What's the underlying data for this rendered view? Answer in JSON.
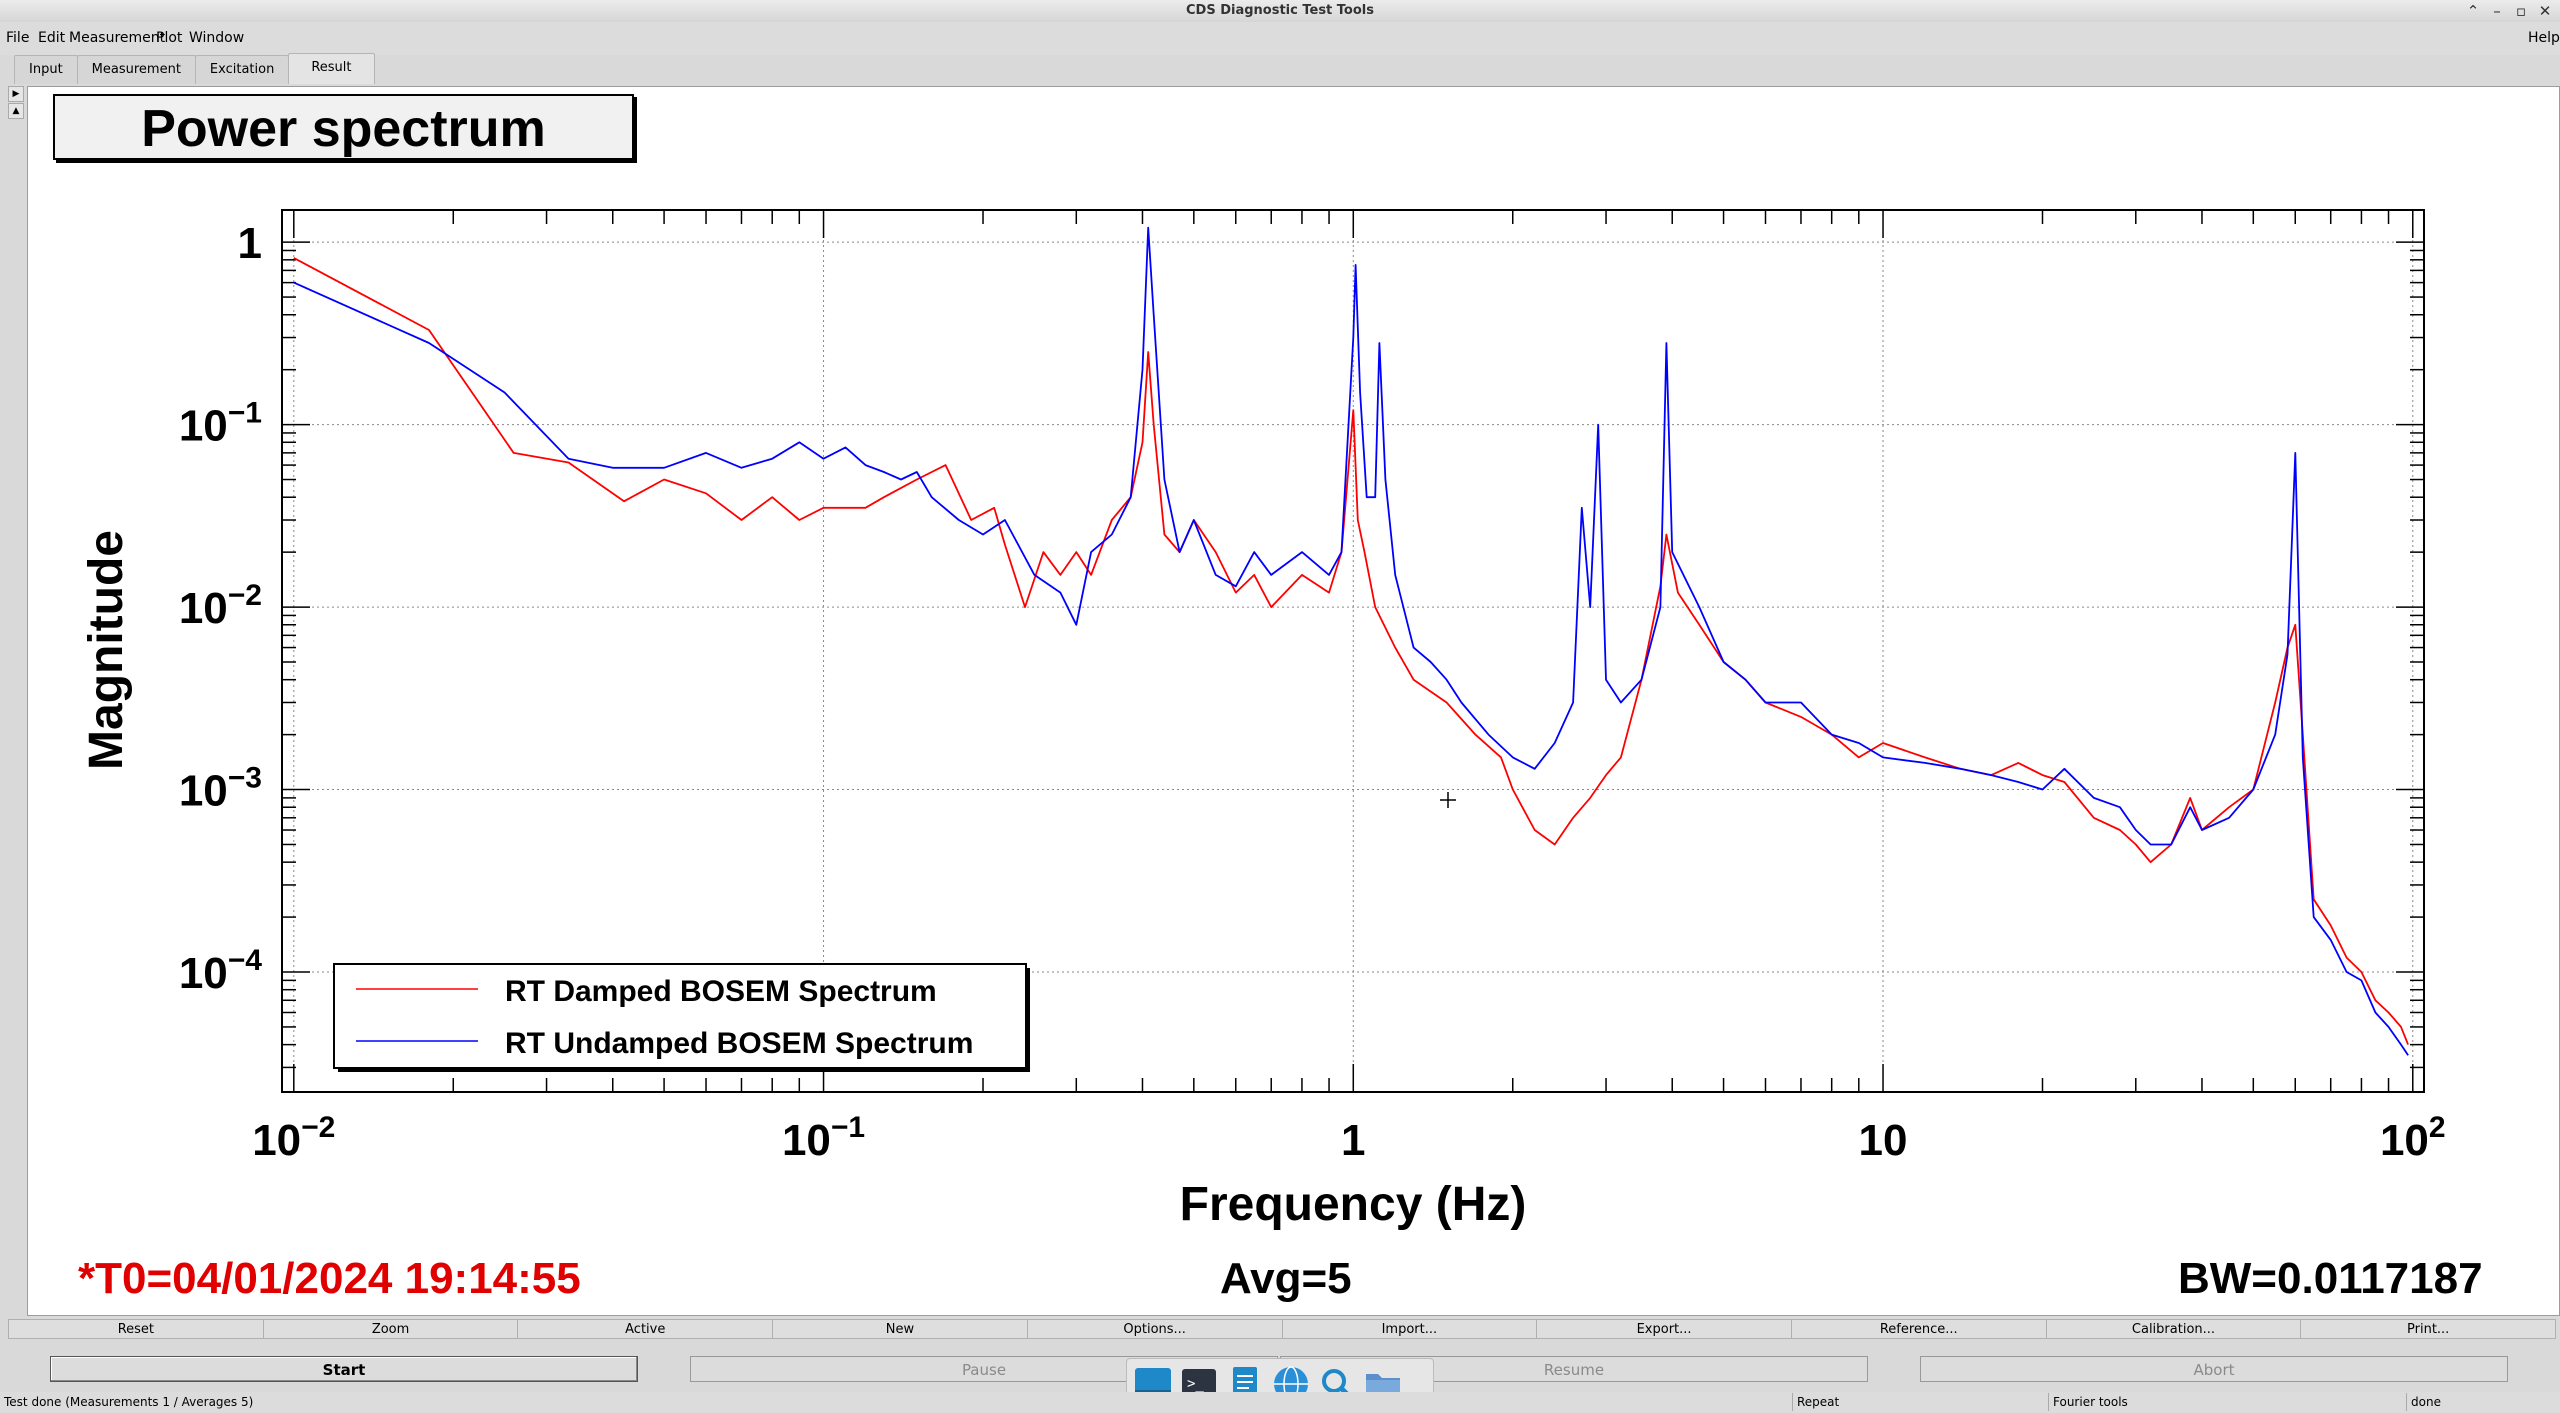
{
  "window": {
    "title": "CDS Diagnostic Test Tools"
  },
  "menu": {
    "file": "File",
    "edit": "Edit",
    "measurement": "Measurement",
    "plot": "Plot",
    "window": "Window",
    "help": "Help"
  },
  "tabs": [
    {
      "label": "Input",
      "active": false
    },
    {
      "label": "Measurement",
      "active": false
    },
    {
      "label": "Excitation",
      "active": false
    },
    {
      "label": "Result",
      "active": true
    }
  ],
  "plot_title": "Power spectrum",
  "chart_data": {
    "type": "line",
    "title": "Power spectrum",
    "xlabel": "Frequency (Hz)",
    "ylabel": "Magnitude",
    "xscale": "log",
    "yscale": "log",
    "xlim": [
      0.0095,
      105
    ],
    "ylim": [
      2.2e-05,
      1.5
    ],
    "x_ticks": [
      0.01,
      0.1,
      1,
      10,
      100
    ],
    "x_tick_labels": [
      {
        "base": "10",
        "exp": "−2"
      },
      {
        "base": "10",
        "exp": "−1"
      },
      {
        "base": "1",
        "exp": ""
      },
      {
        "base": "10",
        "exp": ""
      },
      {
        "base": "10",
        "exp": "2"
      }
    ],
    "y_ticks": [
      0.0001,
      0.001,
      0.01,
      0.1,
      1
    ],
    "y_tick_labels": [
      {
        "base": "10",
        "exp": "−4"
      },
      {
        "base": "10",
        "exp": "−3"
      },
      {
        "base": "10",
        "exp": "−2"
      },
      {
        "base": "10",
        "exp": "−1"
      },
      {
        "base": "1",
        "exp": ""
      }
    ],
    "grid": true,
    "legend_position": "bottom-left",
    "series": [
      {
        "name": "RT Damped BOSEM Spectrum",
        "color": "#ff0000",
        "points": [
          [
            0.01,
            0.82
          ],
          [
            0.018,
            0.33
          ],
          [
            0.026,
            0.07
          ],
          [
            0.033,
            0.062
          ],
          [
            0.042,
            0.038
          ],
          [
            0.05,
            0.05
          ],
          [
            0.06,
            0.042
          ],
          [
            0.07,
            0.03
          ],
          [
            0.08,
            0.04
          ],
          [
            0.09,
            0.03
          ],
          [
            0.1,
            0.035
          ],
          [
            0.12,
            0.035
          ],
          [
            0.13,
            0.04
          ],
          [
            0.15,
            0.05
          ],
          [
            0.17,
            0.06
          ],
          [
            0.19,
            0.03
          ],
          [
            0.21,
            0.035
          ],
          [
            0.22,
            0.022
          ],
          [
            0.24,
            0.01
          ],
          [
            0.26,
            0.02
          ],
          [
            0.28,
            0.015
          ],
          [
            0.3,
            0.02
          ],
          [
            0.32,
            0.015
          ],
          [
            0.35,
            0.03
          ],
          [
            0.38,
            0.04
          ],
          [
            0.4,
            0.08
          ],
          [
            0.41,
            0.25
          ],
          [
            0.42,
            0.1
          ],
          [
            0.44,
            0.025
          ],
          [
            0.47,
            0.02
          ],
          [
            0.5,
            0.03
          ],
          [
            0.55,
            0.02
          ],
          [
            0.6,
            0.012
          ],
          [
            0.65,
            0.015
          ],
          [
            0.7,
            0.01
          ],
          [
            0.8,
            0.015
          ],
          [
            0.9,
            0.012
          ],
          [
            0.95,
            0.02
          ],
          [
            1.0,
            0.12
          ],
          [
            1.02,
            0.03
          ],
          [
            1.05,
            0.02
          ],
          [
            1.1,
            0.01
          ],
          [
            1.2,
            0.006
          ],
          [
            1.3,
            0.004
          ],
          [
            1.5,
            0.003
          ],
          [
            1.7,
            0.002
          ],
          [
            1.9,
            0.0015
          ],
          [
            2.0,
            0.001
          ],
          [
            2.2,
            0.0006
          ],
          [
            2.4,
            0.0005
          ],
          [
            2.6,
            0.0007
          ],
          [
            2.8,
            0.0009
          ],
          [
            3.0,
            0.0012
          ],
          [
            3.2,
            0.0015
          ],
          [
            3.5,
            0.004
          ],
          [
            3.8,
            0.013
          ],
          [
            3.9,
            0.025
          ],
          [
            4.1,
            0.012
          ],
          [
            4.5,
            0.008
          ],
          [
            5,
            0.005
          ],
          [
            5.5,
            0.004
          ],
          [
            6,
            0.003
          ],
          [
            7,
            0.0025
          ],
          [
            8,
            0.002
          ],
          [
            9,
            0.0015
          ],
          [
            10,
            0.0018
          ],
          [
            12,
            0.0015
          ],
          [
            14,
            0.0013
          ],
          [
            16,
            0.0012
          ],
          [
            18,
            0.0014
          ],
          [
            20,
            0.0012
          ],
          [
            22,
            0.0011
          ],
          [
            25,
            0.0007
          ],
          [
            28,
            0.0006
          ],
          [
            30,
            0.0005
          ],
          [
            32,
            0.0004
          ],
          [
            35,
            0.0005
          ],
          [
            38,
            0.0009
          ],
          [
            40,
            0.0006
          ],
          [
            45,
            0.0008
          ],
          [
            50,
            0.001
          ],
          [
            55,
            0.003
          ],
          [
            58,
            0.006
          ],
          [
            60,
            0.008
          ],
          [
            62,
            0.002
          ],
          [
            65,
            0.00025
          ],
          [
            70,
            0.00018
          ],
          [
            75,
            0.00012
          ],
          [
            80,
            0.0001
          ],
          [
            85,
            7e-05
          ],
          [
            90,
            6e-05
          ],
          [
            95,
            5e-05
          ],
          [
            98,
            4e-05
          ]
        ]
      },
      {
        "name": "RT Undamped BOSEM Spectrum",
        "color": "#0000ff",
        "points": [
          [
            0.01,
            0.6
          ],
          [
            0.018,
            0.28
          ],
          [
            0.025,
            0.15
          ],
          [
            0.033,
            0.065
          ],
          [
            0.04,
            0.058
          ],
          [
            0.05,
            0.058
          ],
          [
            0.06,
            0.07
          ],
          [
            0.07,
            0.058
          ],
          [
            0.08,
            0.065
          ],
          [
            0.09,
            0.08
          ],
          [
            0.1,
            0.065
          ],
          [
            0.11,
            0.075
          ],
          [
            0.12,
            0.06
          ],
          [
            0.13,
            0.055
          ],
          [
            0.14,
            0.05
          ],
          [
            0.15,
            0.055
          ],
          [
            0.16,
            0.04
          ],
          [
            0.18,
            0.03
          ],
          [
            0.2,
            0.025
          ],
          [
            0.22,
            0.03
          ],
          [
            0.25,
            0.015
          ],
          [
            0.28,
            0.012
          ],
          [
            0.3,
            0.008
          ],
          [
            0.32,
            0.02
          ],
          [
            0.35,
            0.025
          ],
          [
            0.38,
            0.04
          ],
          [
            0.4,
            0.2
          ],
          [
            0.41,
            1.2
          ],
          [
            0.42,
            0.4
          ],
          [
            0.44,
            0.05
          ],
          [
            0.47,
            0.02
          ],
          [
            0.5,
            0.03
          ],
          [
            0.55,
            0.015
          ],
          [
            0.6,
            0.013
          ],
          [
            0.65,
            0.02
          ],
          [
            0.7,
            0.015
          ],
          [
            0.8,
            0.02
          ],
          [
            0.9,
            0.015
          ],
          [
            0.95,
            0.02
          ],
          [
            1.0,
            0.3
          ],
          [
            1.01,
            0.75
          ],
          [
            1.03,
            0.15
          ],
          [
            1.06,
            0.04
          ],
          [
            1.1,
            0.04
          ],
          [
            1.12,
            0.28
          ],
          [
            1.15,
            0.05
          ],
          [
            1.2,
            0.015
          ],
          [
            1.3,
            0.006
          ],
          [
            1.4,
            0.005
          ],
          [
            1.5,
            0.004
          ],
          [
            1.6,
            0.003
          ],
          [
            1.8,
            0.002
          ],
          [
            2.0,
            0.0015
          ],
          [
            2.2,
            0.0013
          ],
          [
            2.4,
            0.0018
          ],
          [
            2.6,
            0.003
          ],
          [
            2.7,
            0.035
          ],
          [
            2.8,
            0.01
          ],
          [
            2.9,
            0.1
          ],
          [
            3.0,
            0.004
          ],
          [
            3.2,
            0.003
          ],
          [
            3.5,
            0.004
          ],
          [
            3.8,
            0.01
          ],
          [
            3.9,
            0.28
          ],
          [
            4.0,
            0.02
          ],
          [
            4.5,
            0.01
          ],
          [
            5,
            0.005
          ],
          [
            5.5,
            0.004
          ],
          [
            6,
            0.003
          ],
          [
            7,
            0.003
          ],
          [
            8,
            0.002
          ],
          [
            9,
            0.0018
          ],
          [
            10,
            0.0015
          ],
          [
            12,
            0.0014
          ],
          [
            14,
            0.0013
          ],
          [
            16,
            0.0012
          ],
          [
            18,
            0.0011
          ],
          [
            20,
            0.001
          ],
          [
            22,
            0.0013
          ],
          [
            25,
            0.0009
          ],
          [
            28,
            0.0008
          ],
          [
            30,
            0.0006
          ],
          [
            32,
            0.0005
          ],
          [
            35,
            0.0005
          ],
          [
            38,
            0.0008
          ],
          [
            40,
            0.0006
          ],
          [
            45,
            0.0007
          ],
          [
            50,
            0.001
          ],
          [
            55,
            0.002
          ],
          [
            58,
            0.0055
          ],
          [
            60,
            0.07
          ],
          [
            62,
            0.0015
          ],
          [
            65,
            0.0002
          ],
          [
            70,
            0.00015
          ],
          [
            75,
            0.0001
          ],
          [
            80,
            9e-05
          ],
          [
            85,
            6e-05
          ],
          [
            90,
            5e-05
          ],
          [
            95,
            4e-05
          ],
          [
            98,
            3.5e-05
          ]
        ]
      }
    ]
  },
  "footer": {
    "t0": "*T0=04/01/2024 19:14:55",
    "avg": "Avg=5",
    "bw": "BW=0.0117187"
  },
  "toolbar": [
    "Reset",
    "Zoom",
    "Active",
    "New",
    "Options...",
    "Import...",
    "Export...",
    "Reference...",
    "Calibration...",
    "Print..."
  ],
  "controls": {
    "start": "Start",
    "pause": "Pause",
    "resume": "Resume",
    "abort": "Abort"
  },
  "status": {
    "main": "Test done (Measurements 1 / Averages 5)",
    "repeat": "Repeat",
    "tool": "Fourier tools",
    "state": "done"
  },
  "colors": {
    "damped": "#ff0000",
    "undamped": "#0000ff",
    "t0_text": "#e00000"
  },
  "dock_icons": [
    "desktop-icon",
    "terminal-icon",
    "text-editor-icon",
    "browser-globe-icon",
    "search-icon",
    "folder-icon"
  ]
}
